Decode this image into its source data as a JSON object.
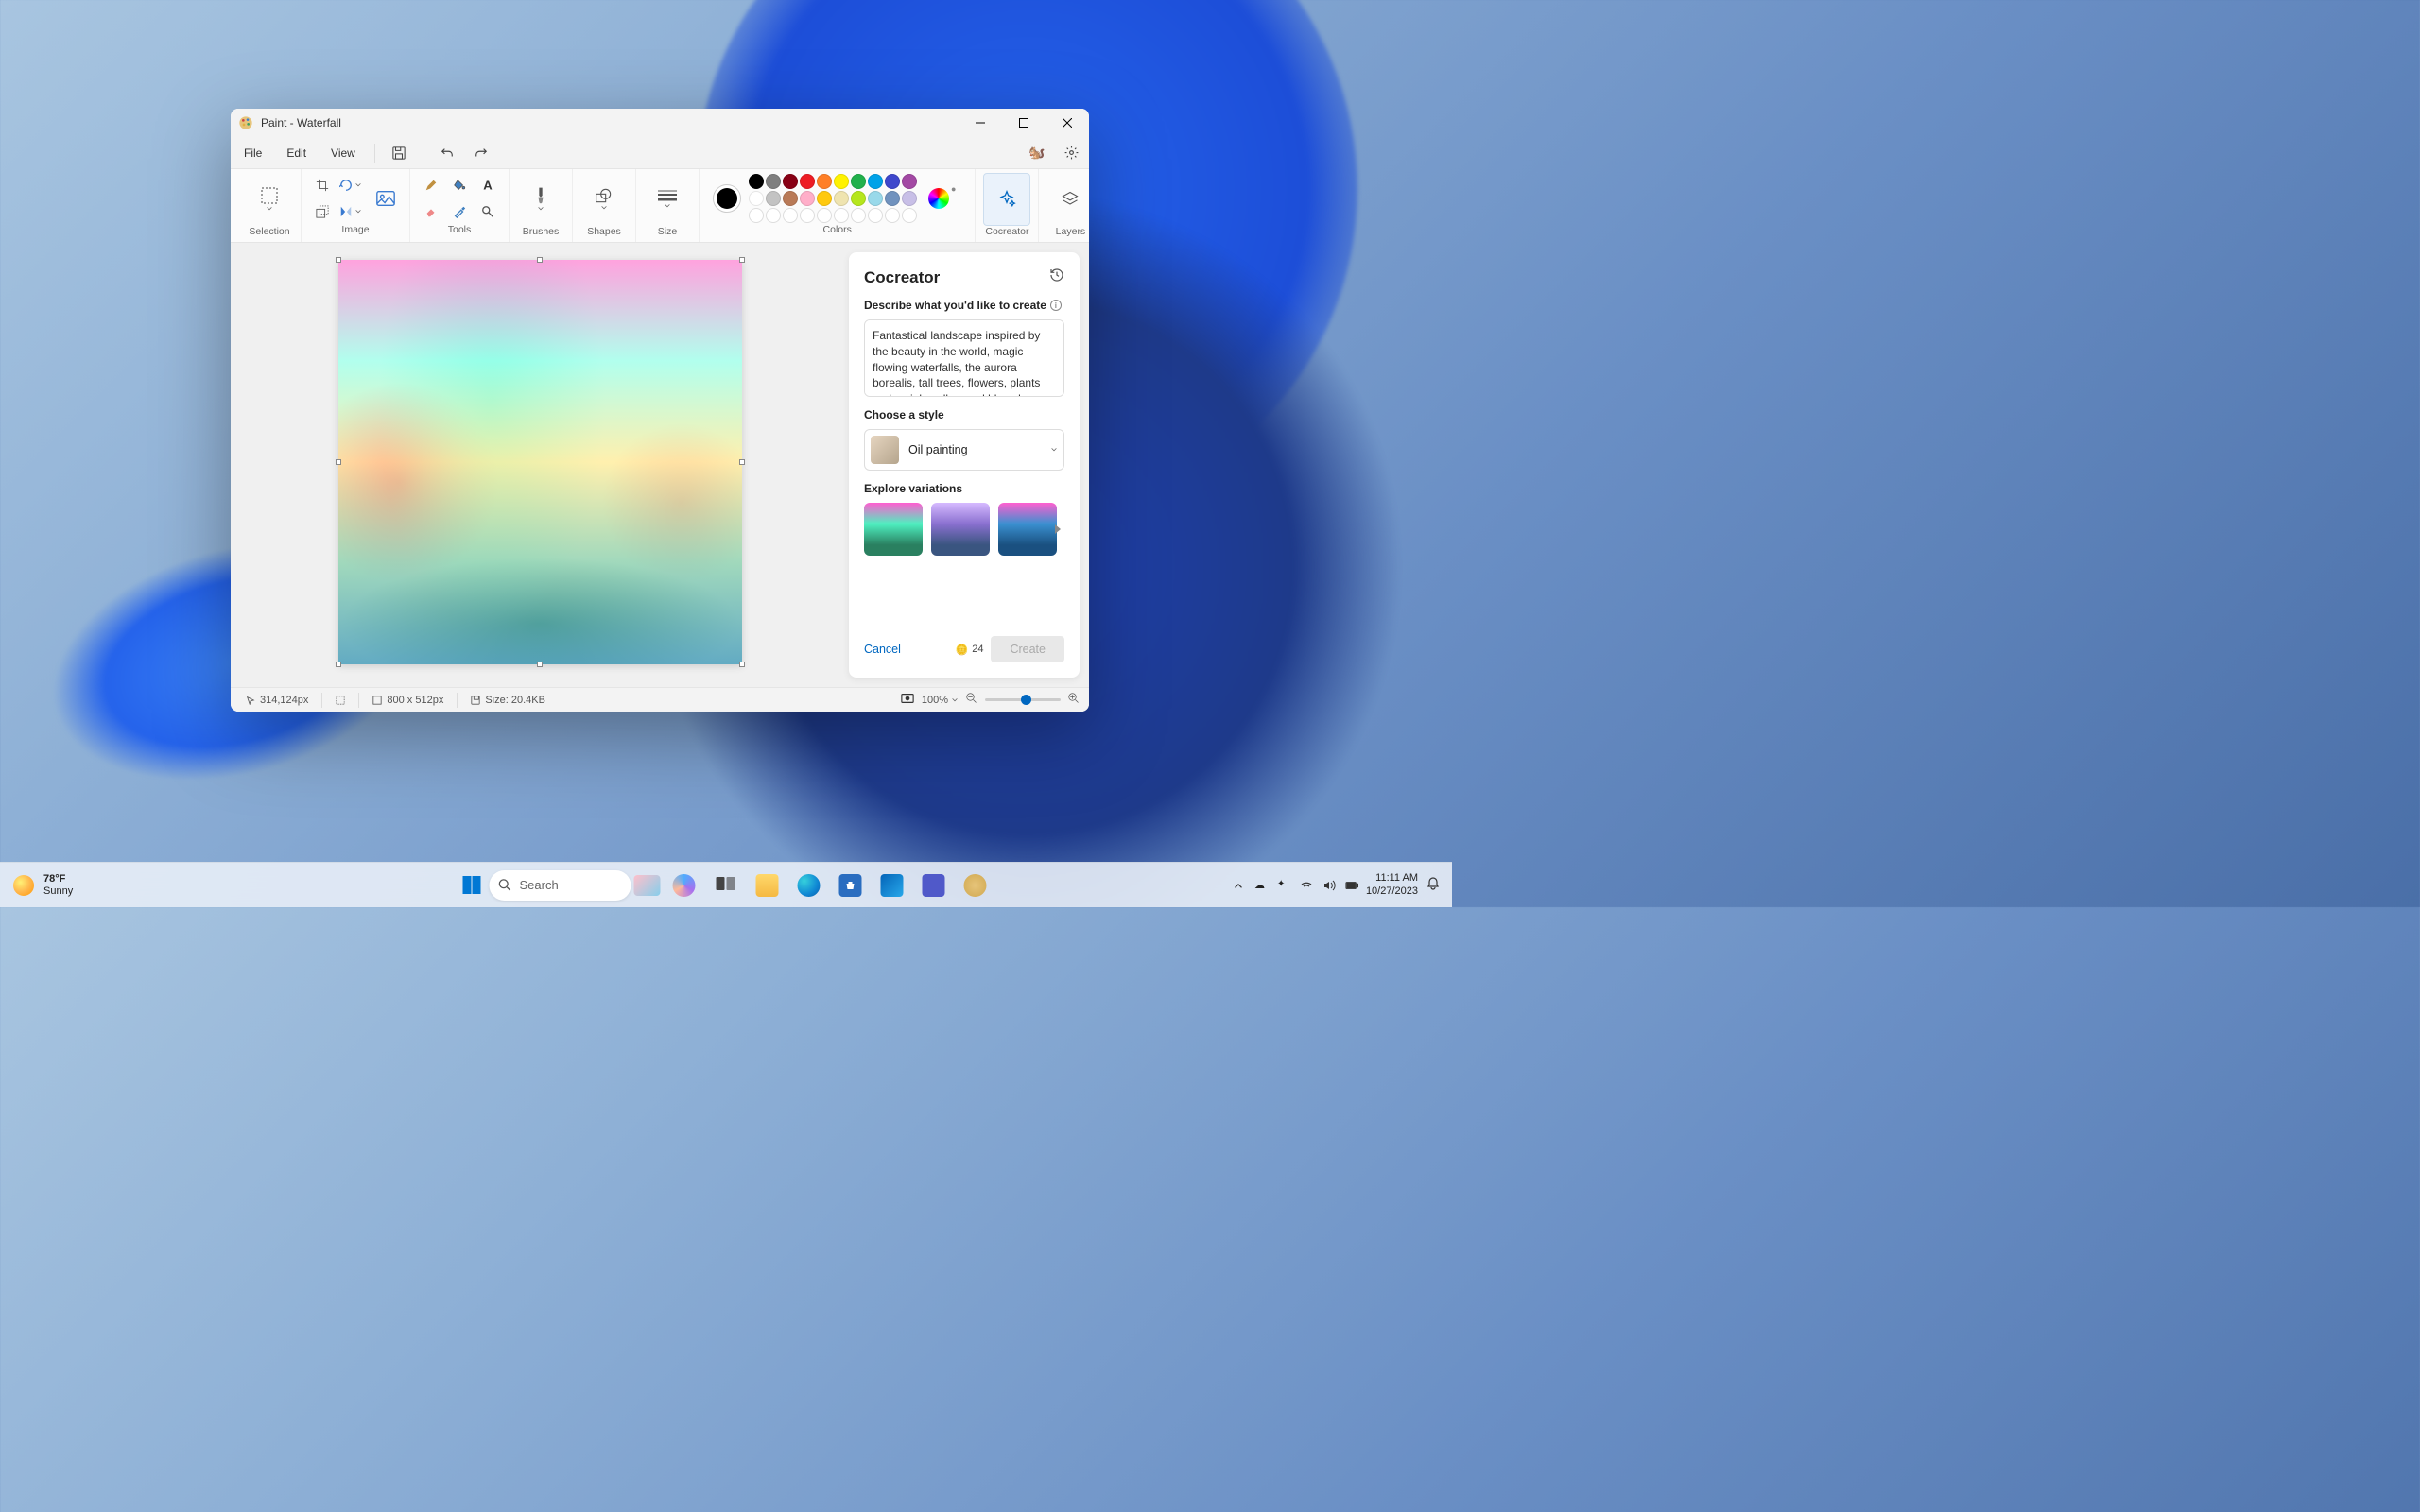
{
  "window": {
    "title": "Paint - Waterfall"
  },
  "menubar": {
    "file": "File",
    "edit": "Edit",
    "view": "View"
  },
  "ribbon": {
    "selection_label": "Selection",
    "image_label": "Image",
    "tools_label": "Tools",
    "brushes_label": "Brushes",
    "shapes_label": "Shapes",
    "size_label": "Size",
    "colors_label": "Colors",
    "cocreator_label": "Cocreator",
    "layers_label": "Layers",
    "swatch_row1": [
      "#000000",
      "#7f7f7f",
      "#880015",
      "#ed1c24",
      "#ff7f27",
      "#fff200",
      "#22b14c",
      "#00a2e8",
      "#3f48cc",
      "#a349a4"
    ],
    "swatch_row2": [
      "#ffffff",
      "#c3c3c3",
      "#b97a57",
      "#ffaec9",
      "#ffc90e",
      "#efe4b0",
      "#b5e61d",
      "#99d9ea",
      "#7092be",
      "#c8bfe7"
    ],
    "swatch_row3_empty": 10
  },
  "cocreator": {
    "title": "Cocreator",
    "describe_label": "Describe what you'd like to create",
    "prompt_text": "Fantastical landscape inspired by the beauty in the world, magic flowing waterfalls, the aurora borealis, tall trees, flowers, plants and a pink, yellow and blue sky.",
    "style_label": "Choose a style",
    "style_name": "Oil painting",
    "variations_label": "Explore variations",
    "cancel": "Cancel",
    "credits": "24",
    "create": "Create"
  },
  "statusbar": {
    "cursor_pos": "314,124px",
    "dims": "800  x  512px",
    "size_label": "Size: 20.4KB",
    "zoom": "100%"
  },
  "taskbar": {
    "temp": "78°F",
    "condition": "Sunny",
    "search": "Search",
    "time": "11:11 AM",
    "date": "10/27/2023"
  }
}
